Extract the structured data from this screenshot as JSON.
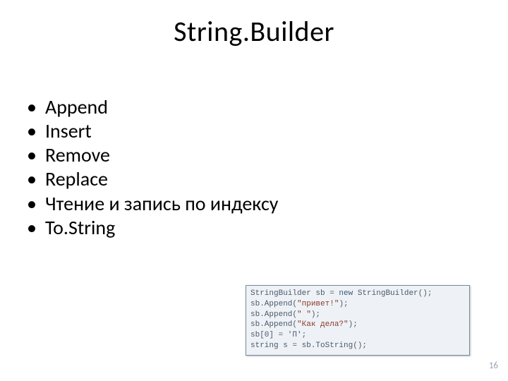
{
  "title": "String.Builder",
  "bullets": [
    "Append",
    "Insert",
    "Remove",
    "Replace",
    "Чтение и запись по индексу",
    "To.String"
  ],
  "code": {
    "l1a": "StringBuilder sb = ",
    "l1b": "new",
    "l1c": " StringBuilder();",
    "l2a": "sb.Append(",
    "l2b": "\"привет!\"",
    "l2c": ");",
    "l3a": "sb.Append(",
    "l3b": "\" \"",
    "l3c": ");",
    "l4a": "sb.Append(",
    "l4b": "\"Как дела?\"",
    "l4c": ");",
    "l5": "sb[0] = 'П';",
    "l6": "string s = sb.ToString();"
  },
  "page_number": "16"
}
